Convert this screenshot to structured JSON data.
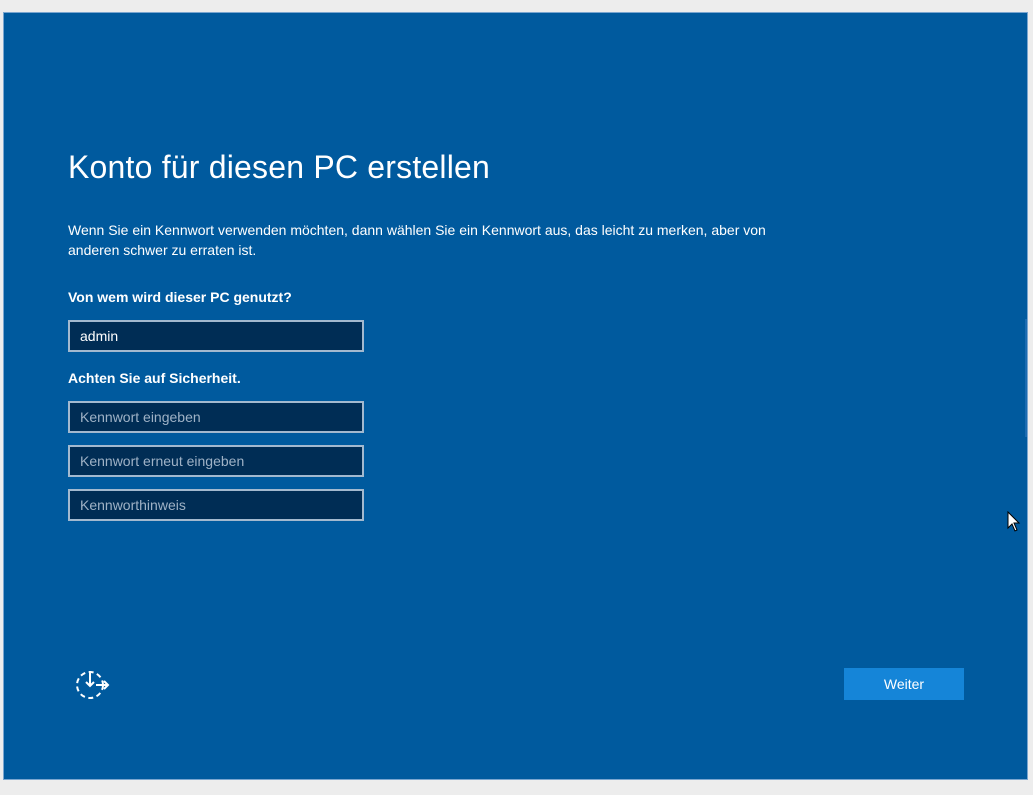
{
  "page": {
    "title": "Konto für diesen PC erstellen",
    "description": "Wenn Sie ein Kennwort verwenden möchten, dann wählen Sie ein Kennwort aus, das leicht zu merken, aber von anderen schwer zu erraten ist."
  },
  "form": {
    "user_label": "Von wem wird dieser PC genutzt?",
    "username_value": "admin",
    "security_label": "Achten Sie auf Sicherheit.",
    "password_placeholder": "Kennwort eingeben",
    "password_confirm_placeholder": "Kennwort erneut eingeben",
    "hint_placeholder": "Kennworthinweis"
  },
  "footer": {
    "next_label": "Weiter",
    "accessibility_icon": "ease-of-access-icon"
  },
  "colors": {
    "background": "#005a9e",
    "input_background": "#002d55",
    "button": "#1585d8"
  }
}
